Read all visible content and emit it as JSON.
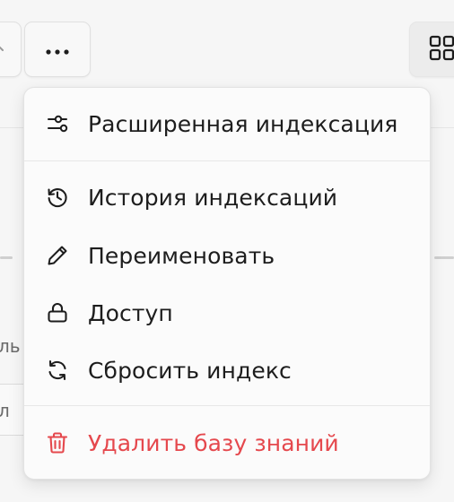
{
  "menu": {
    "items": [
      {
        "label": "Расширенная индексация",
        "icon": "sliders-icon"
      },
      {
        "label": "История индексаций",
        "icon": "history-icon"
      },
      {
        "label": "Переименовать",
        "icon": "pencil-icon"
      },
      {
        "label": "Доступ",
        "icon": "lock-icon"
      },
      {
        "label": "Сбросить индекс",
        "icon": "refresh-icon"
      },
      {
        "label": "Удалить базу знаний",
        "icon": "trash-icon"
      }
    ]
  },
  "background": {
    "text_1": "ль",
    "text_2": "л"
  },
  "colors": {
    "danger": "#e5484d",
    "text": "#1d1d1d"
  }
}
